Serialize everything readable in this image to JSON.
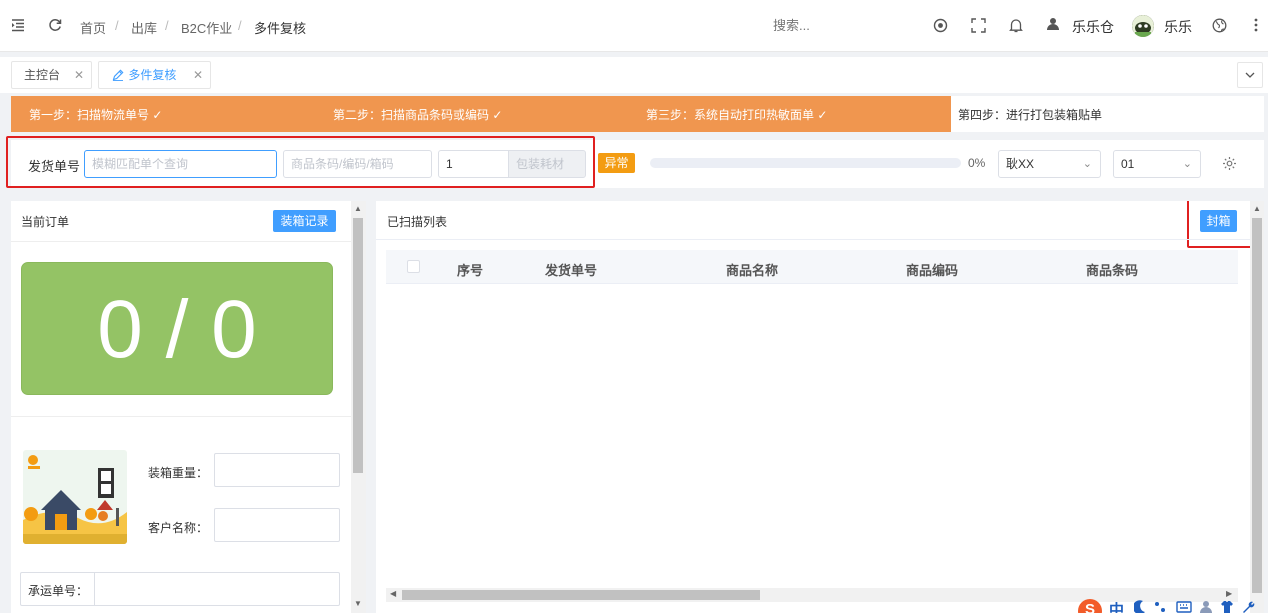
{
  "header": {
    "breadcrumbs": [
      "首页",
      "出库",
      "B2C作业",
      "多件复核"
    ],
    "search_placeholder": "搜索...",
    "warehouse": "乐乐仓",
    "username": "乐乐"
  },
  "tabs": [
    {
      "label": "主控台",
      "active": false
    },
    {
      "label": "多件复核",
      "active": true
    }
  ],
  "steps": [
    {
      "label": "第一步：扫描物流单号 ✓",
      "done": true
    },
    {
      "label": "第二步：扫描商品条码或编码 ✓",
      "done": true
    },
    {
      "label": "第三步：系统自动打印热敏面单 ✓",
      "done": true
    },
    {
      "label": "第四步：进行打包装箱贴单",
      "done": false
    }
  ],
  "scan_form": {
    "order_label": "发货单号",
    "order_placeholder": "模糊匹配单个查询",
    "product_placeholder": "商品条码/编码/箱码",
    "quantity_value": "1",
    "packaging_placeholder": "包装耗材",
    "exception_button": "异常",
    "progress": 0,
    "progress_text": "0%",
    "operator_select": "耿XX",
    "station_select": "01"
  },
  "left_panel": {
    "title": "当前订单",
    "packing_record_button": "装箱记录",
    "counter": "0 / 0",
    "weight_label": "装箱重量：",
    "customer_label": "客户名称：",
    "carrier_label": "承运单号："
  },
  "right_panel": {
    "title": "已扫描列表",
    "seal_button": "封箱",
    "columns": [
      "序号",
      "发货单号",
      "商品名称",
      "商品编码",
      "商品条码"
    ]
  },
  "ime_bar": {
    "logo": "S",
    "mode": "中"
  },
  "colors": {
    "accent": "#409eff",
    "steps_done": "#f0964f",
    "counter_bg": "#94c365",
    "exception": "#f39c12",
    "highlight": "#e02020"
  }
}
